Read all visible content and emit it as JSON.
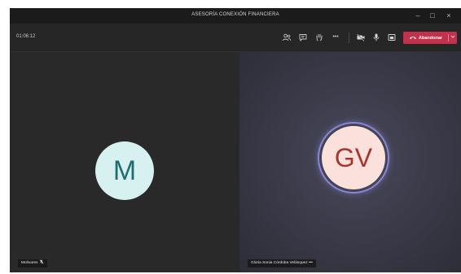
{
  "window": {
    "title": "ASESORÍA CONEXIÓN FINANCIERA",
    "controls": {
      "minimize": "–",
      "maximize": "□",
      "close": "×"
    }
  },
  "toolbar": {
    "timer": "01:06:12",
    "icons": [
      "participants-icon",
      "chat-icon",
      "raise-hand-icon",
      "more-icon",
      "camera-off-icon",
      "microphone-icon",
      "share-screen-icon"
    ],
    "more_label": "•••",
    "leave_label": "Abandonar",
    "leave_color": "#c4314b"
  },
  "participants": [
    {
      "initials": "M",
      "name": "Molivares",
      "avatar_bg": "#d7f0f0",
      "avatar_fg": "#1f6f72",
      "muted": true,
      "speaking": false
    },
    {
      "initials": "GV",
      "name": "Gloria Sonia Córdoba Velásquez",
      "avatar_bg": "#fbe0dc",
      "avatar_fg": "#a8362f",
      "muted": false,
      "speaking": true,
      "more_label": "•••"
    }
  ]
}
